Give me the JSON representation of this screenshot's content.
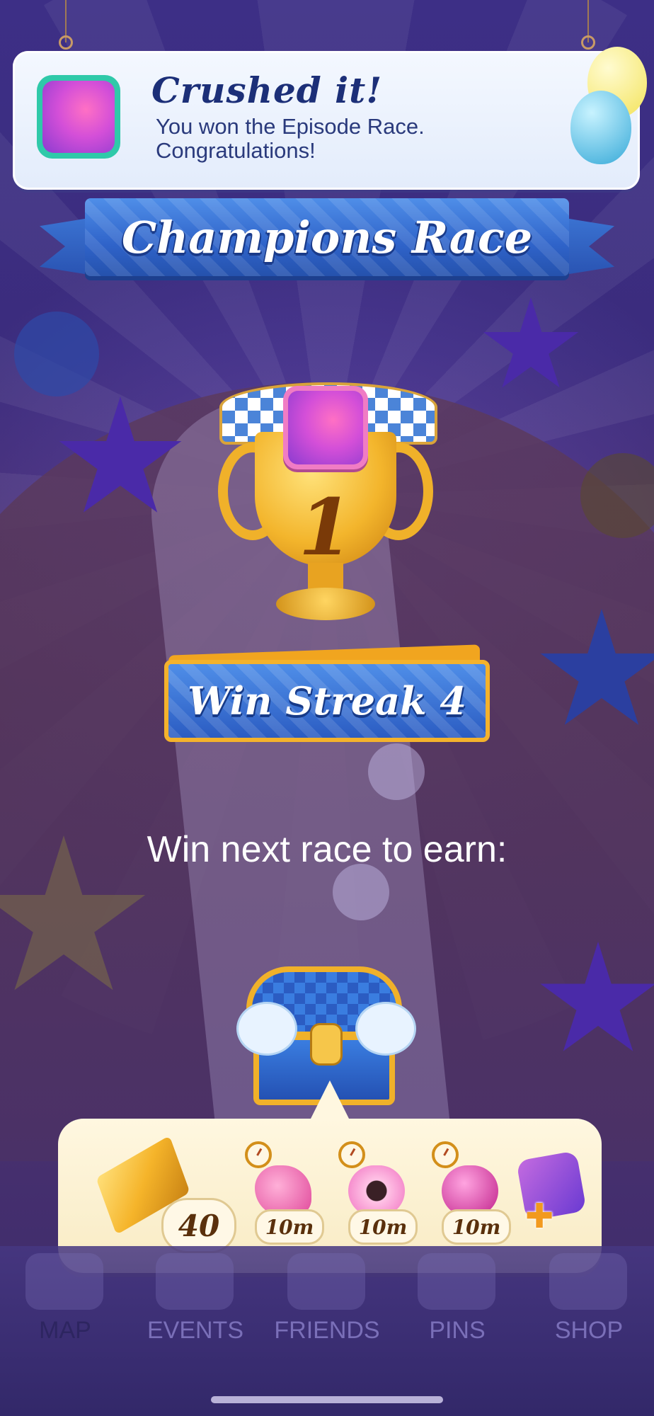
{
  "notification": {
    "title": "Crushed it!",
    "message_line1": "You won the Episode Race.",
    "message_line2": "Congratulations!",
    "icon": "player-avatar-icon"
  },
  "banner": {
    "title": "Champions Race"
  },
  "trophy": {
    "place": "1",
    "icon": "trophy-icon"
  },
  "streak": {
    "label": "Win Streak 4"
  },
  "next_race": {
    "prompt": "Win next race to earn:"
  },
  "rewards": {
    "gold_bars": {
      "icon": "gold-bar-icon",
      "count": "40"
    },
    "boosters": [
      {
        "icon": "swedish-fish-icon",
        "duration": "10m"
      },
      {
        "icon": "donut-icon",
        "duration": "10m"
      },
      {
        "icon": "lollipop-hammer-icon",
        "duration": "10m"
      }
    ],
    "extra": {
      "icon": "color-bomb-plus-icon"
    }
  },
  "bottom_nav": {
    "items": [
      {
        "label": "MAP",
        "active": true
      },
      {
        "label": "EVENTS",
        "active": false
      },
      {
        "label": "FRIENDS",
        "active": false
      },
      {
        "label": "PINS",
        "active": false
      },
      {
        "label": "SHOP",
        "active": false
      }
    ]
  },
  "colors": {
    "banner_blue": "#2f63c9",
    "gold": "#f0b12a",
    "panel_cream": "#fff7e0",
    "title_navy": "#1c2f78"
  }
}
